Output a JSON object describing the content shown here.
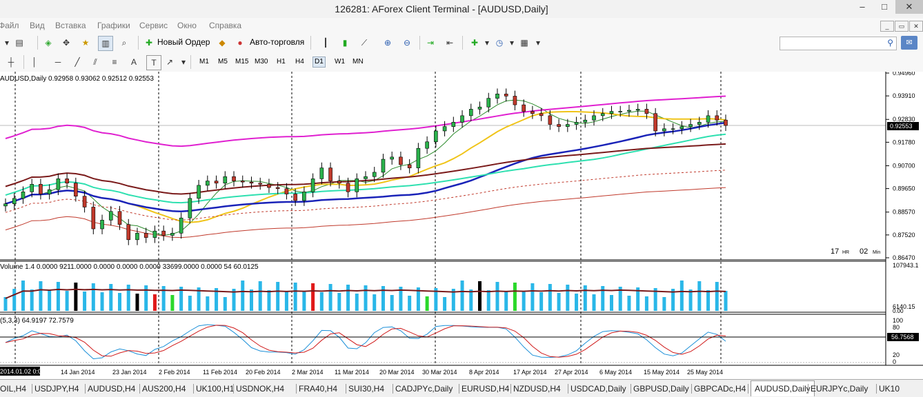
{
  "window": {
    "title": "126281: AForex Client Terminal - [AUDUSD,Daily]",
    "minimize": "–",
    "maximize": "□",
    "close": "✕"
  },
  "menu": [
    "Файл",
    "Вид",
    "Вставка",
    "Графики",
    "Сервис",
    "Окно",
    "Справка"
  ],
  "toolbar": {
    "new_order": "Новый Ордер",
    "auto_trading": "Авто-торговля",
    "search_placeholder": ""
  },
  "drawing_tools": [
    "A",
    "T"
  ],
  "timeframes": [
    "M1",
    "M5",
    "M15",
    "M30",
    "H1",
    "H4",
    "D1",
    "W1",
    "MN"
  ],
  "active_timeframe": "D1",
  "chart": {
    "header": "AUDUSD,Daily  0.92958 0.93062 0.92512 0.92553",
    "current_price": "0.92553",
    "price_ticks": [
      "0.94960",
      "0.93910",
      "0.92830",
      "0.91780",
      "0.90700",
      "0.89650",
      "0.88570",
      "0.87520",
      "0.86470"
    ],
    "countdown_hr": "17",
    "countdown_hr_label": "HR",
    "countdown_min": "02",
    "countdown_min_label": "Min",
    "volume_header": "Volume 1.4 0.0000 9211.0000 0.0000 0.0000 0.0000 33699.0000 0.0000  54 60.0125",
    "volume_ticks": [
      "107943.1",
      "6140.15",
      "0.00"
    ],
    "stoch_header": "(5,3,3) 64.9197 72.7579",
    "stoch_ticks": [
      "100",
      "80",
      "20",
      "0"
    ],
    "stoch_value": "56.7568",
    "date_cursor": "2014.01.02 0:00",
    "dates": [
      "14 Jan 2014",
      "23 Jan 2014",
      "2 Feb 2014",
      "11 Feb 2014",
      "20 Feb 2014",
      "2 Mar 2014",
      "11 Mar 2014",
      "20 Mar 2014",
      "30 Mar 2014",
      "8 Apr 2014",
      "17 Apr 2014",
      "27 Apr 2014",
      "6 May 2014",
      "15 May 2014",
      "25 May 2014"
    ]
  },
  "chart_data": {
    "type": "candlestick",
    "symbol": "AUDUSD",
    "timeframe": "Daily",
    "ylim": [
      0.8647,
      0.9496
    ],
    "closes": [
      0.8895,
      0.892,
      0.895,
      0.8985,
      0.894,
      0.896,
      0.901,
      0.899,
      0.893,
      0.888,
      0.878,
      0.882,
      0.886,
      0.88,
      0.873,
      0.876,
      0.874,
      0.877,
      0.875,
      0.876,
      0.883,
      0.892,
      0.898,
      0.9,
      0.899,
      0.902,
      0.9,
      0.8995,
      0.899,
      0.8985,
      0.897,
      0.8965,
      0.894,
      0.891,
      0.895,
      0.901,
      0.906,
      0.9,
      0.899,
      0.895,
      0.901,
      0.902,
      0.904,
      0.91,
      0.911,
      0.9075,
      0.906,
      0.915,
      0.918,
      0.923,
      0.925,
      0.927,
      0.93,
      0.933,
      0.934,
      0.938,
      0.94,
      0.939,
      0.935,
      0.932,
      0.931,
      0.93,
      0.926,
      0.925,
      0.926,
      0.927,
      0.928,
      0.93,
      0.931,
      0.932,
      0.932,
      0.9325,
      0.933,
      0.931,
      0.923,
      0.924,
      0.924,
      0.925,
      0.926,
      0.927,
      0.93,
      0.928,
      0.9255
    ]
  },
  "tabs": [
    "OIL,H4",
    "USDJPY,H4",
    "AUDUSD,H4",
    "AUS200,H4",
    "UK100,H1",
    "USDNOK,H4",
    "FRA40,H4",
    "SUI30,H4",
    "CADJPYc,Daily",
    "EURUSD,H4",
    "NZDUSD,H4",
    "USDCAD,Daily",
    "GBPUSD,Daily",
    "GBPCADc,H4",
    "AUDUSD,Daily",
    "EURJPYc,Daily",
    "UK10"
  ],
  "active_tab": "AUDUSD,Daily"
}
